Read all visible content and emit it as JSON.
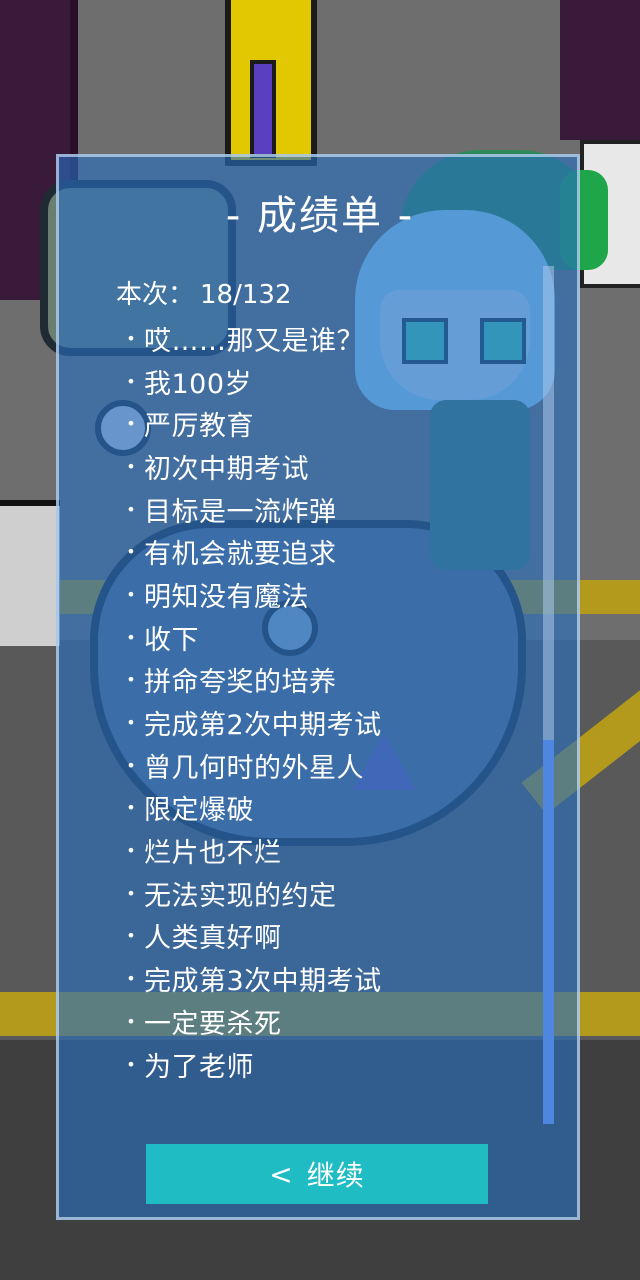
{
  "dialog": {
    "title": "- 成绩单 -",
    "count_label": "本次：",
    "count_value": "18/132",
    "items": [
      {
        "label": "哎……那又是谁？"
      },
      {
        "label": "我100岁"
      },
      {
        "label": "严厉教育"
      },
      {
        "label": "初次中期考试"
      },
      {
        "label": "目标是一流炸弹"
      },
      {
        "label": "有机会就要追求"
      },
      {
        "label": "明知没有魔法"
      },
      {
        "label": "收下"
      },
      {
        "label": "拼命夸奖的培养"
      },
      {
        "label": "完成第2次中期考试"
      },
      {
        "label": "曾几何时的外星人"
      },
      {
        "label": "限定爆破"
      },
      {
        "label": "烂片也不烂"
      },
      {
        "label": "无法实现的约定"
      },
      {
        "label": "人类真好啊"
      },
      {
        "label": "完成第3次中期考试"
      },
      {
        "label": "一定要杀死"
      },
      {
        "label": "为了老师"
      }
    ],
    "bullet": "•",
    "continue_button": {
      "icon": "chevron-left-icon",
      "icon_glyph": "<",
      "label": "继续"
    }
  },
  "colors": {
    "panel_fill": "#286ebe",
    "button": "#1fbcc4",
    "scroll_thumb": "#4f86e0",
    "text": "#ffffff"
  }
}
